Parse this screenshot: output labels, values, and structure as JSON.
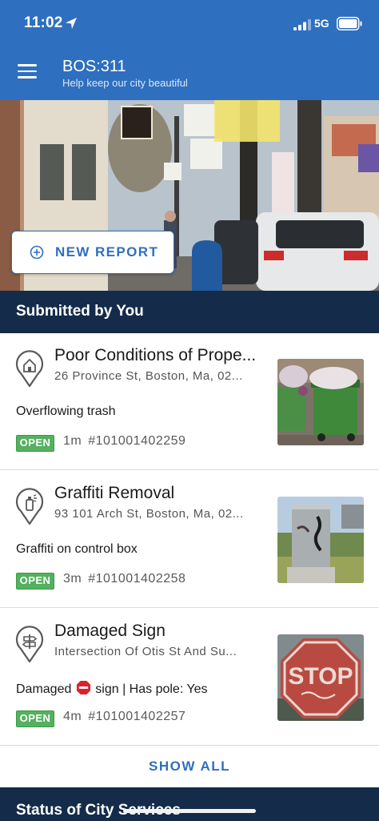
{
  "status_bar": {
    "time": "11:02",
    "network": "5G",
    "icons": [
      "location-arrow-icon",
      "signal-icon",
      "battery-icon"
    ]
  },
  "header": {
    "title": "BOS:311",
    "subtitle": "Help keep our city beautiful",
    "menu_icon": "hamburger-menu-icon"
  },
  "hero": {
    "new_report_label": "NEW REPORT",
    "new_report_icon": "plus-circle-icon"
  },
  "submitted_section": {
    "title": "Submitted by You",
    "reports": [
      {
        "title": "Poor Conditions of Prope...",
        "address": "26 Province St, Boston, Ma, 02...",
        "description": "Overflowing trash",
        "status": "OPEN",
        "age": "1m",
        "case_number": "#101001402259",
        "icon": "house-pin-icon"
      },
      {
        "title": "Graffiti Removal",
        "address": "93 101 Arch St, Boston, Ma, 02...",
        "description": "Graffiti on control box",
        "status": "OPEN",
        "age": "3m",
        "case_number": "#101001402258",
        "icon": "spray-can-pin-icon"
      },
      {
        "title": "Damaged Sign",
        "address": "Intersection Of Otis St And Su...",
        "description_before": "Damaged",
        "description_after": "sign | Has pole: Yes",
        "status": "OPEN",
        "age": "4m",
        "case_number": "#101001402257",
        "icon": "signpost-pin-icon"
      }
    ],
    "show_all_label": "SHOW ALL"
  },
  "city_services_section": {
    "title": "Status of City Services"
  },
  "colors": {
    "brand_blue": "#2f6fbf",
    "navy": "#142c4a",
    "open_green": "#55b05f"
  }
}
